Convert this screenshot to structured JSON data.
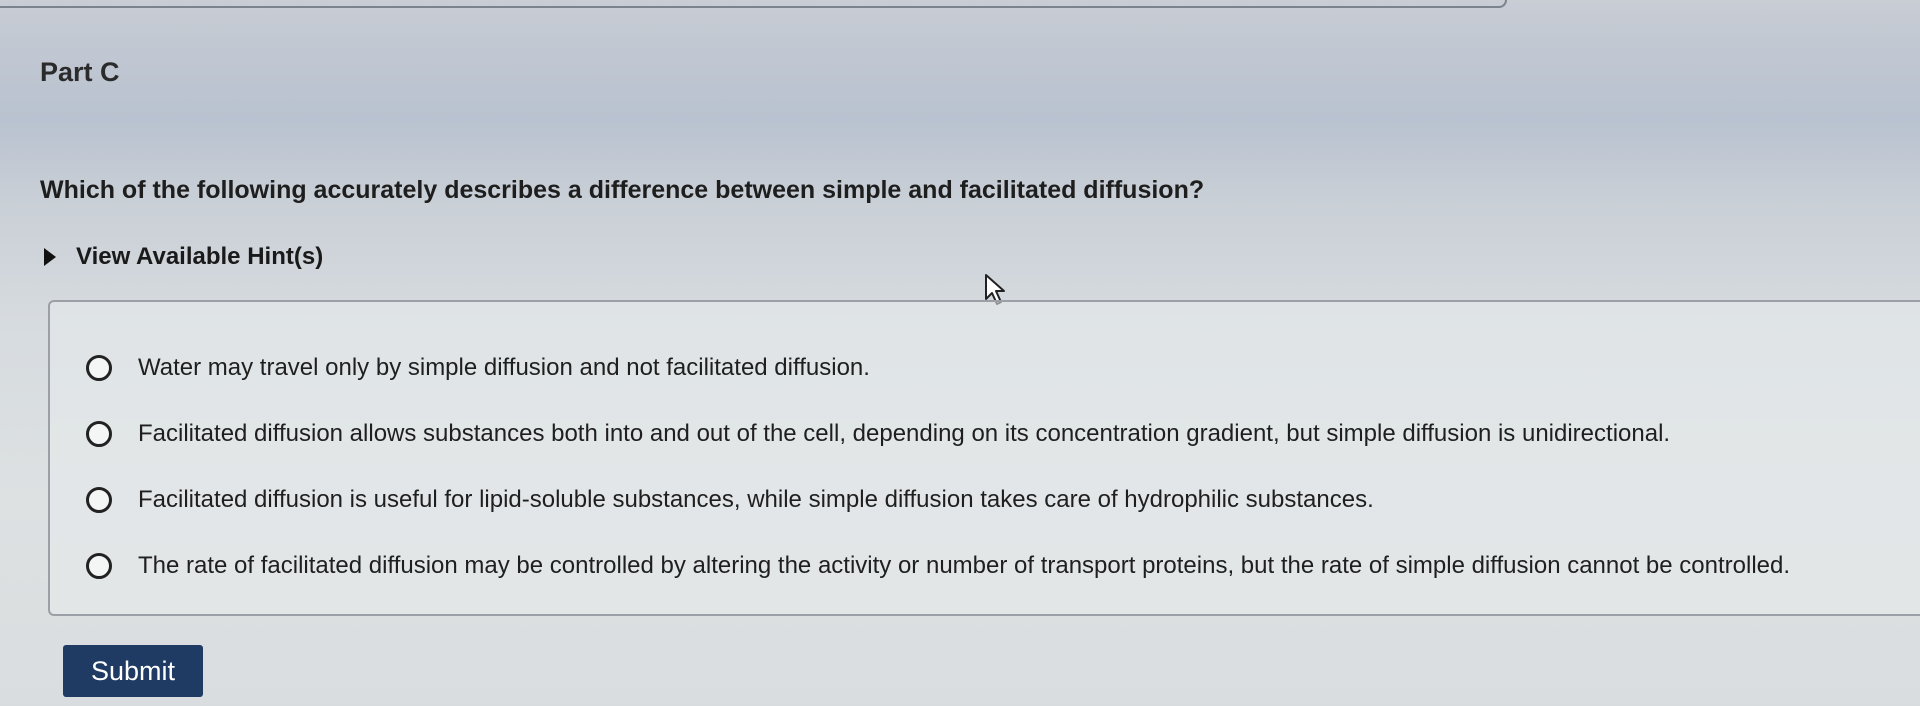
{
  "part": {
    "title": "Part C"
  },
  "question": {
    "text": "Which of the following accurately describes a difference between simple and facilitated diffusion?"
  },
  "hint": {
    "label": "View Available Hint(s)"
  },
  "choices": [
    {
      "text": "Water may travel only by simple diffusion and not facilitated diffusion."
    },
    {
      "text": "Facilitated diffusion allows substances both into and out of the cell, depending on its concentration gradient, but simple diffusion is unidirectional."
    },
    {
      "text": "Facilitated diffusion is useful for lipid-soluble substances, while simple diffusion takes care of hydrophilic substances."
    },
    {
      "text": "The rate of facilitated diffusion may be controlled by altering the activity or number of transport proteins, but the rate of simple diffusion cannot be controlled."
    }
  ],
  "submit": {
    "label": "Submit"
  },
  "colors": {
    "submit_bg": "#1f3a63",
    "submit_text": "#ffffff",
    "text": "#1c1c1c"
  },
  "icons": {
    "hint_toggle": "triangle-right-icon",
    "pointer": "mouse-cursor-icon"
  }
}
